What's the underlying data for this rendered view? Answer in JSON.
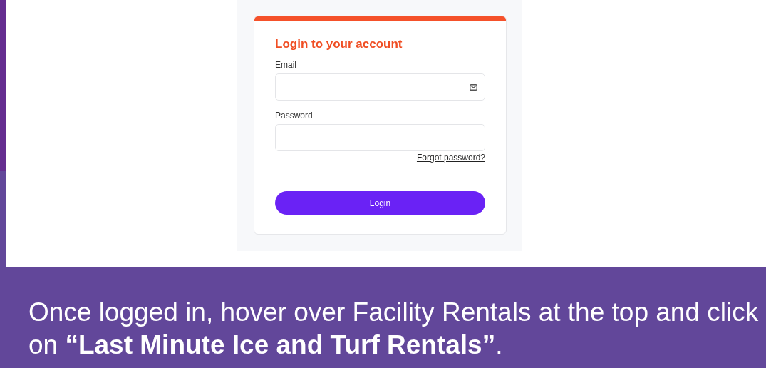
{
  "login_card": {
    "title": "Login to your account",
    "fields": [
      {
        "label": "Email",
        "kind": "email"
      },
      {
        "label": "Password",
        "kind": "password"
      }
    ],
    "forgot_link": "Forgot password?",
    "button": "Login"
  },
  "instruction": "Once logged in, hover over Facility Rentals at the top and click on **“Last Minute Ice and Turf Rentals”**."
}
